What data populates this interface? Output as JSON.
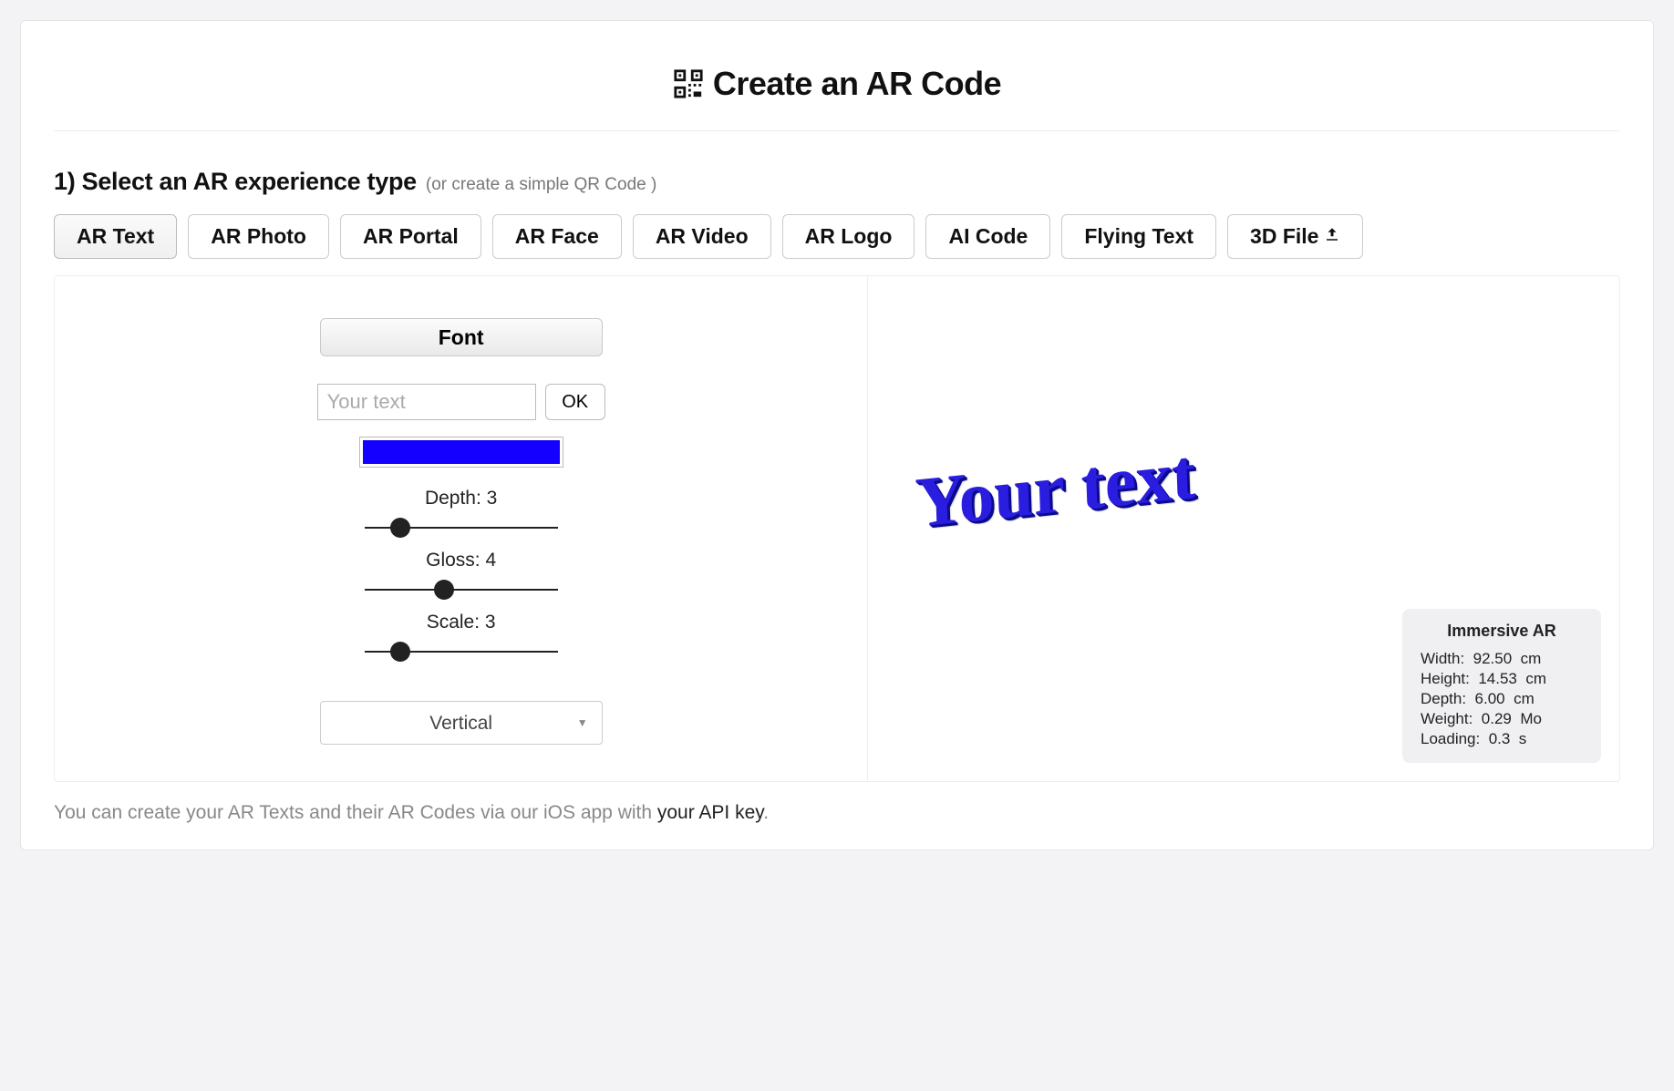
{
  "header": {
    "title": "Create an AR Code",
    "icon": "qr-code-icon"
  },
  "step1": {
    "heading": "1) Select an AR experience type",
    "hint": "(or create a simple QR Code )"
  },
  "tabs": [
    {
      "id": "ar-text",
      "label": "AR Text",
      "active": true
    },
    {
      "id": "ar-photo",
      "label": "AR Photo",
      "active": false
    },
    {
      "id": "ar-portal",
      "label": "AR Portal",
      "active": false
    },
    {
      "id": "ar-face",
      "label": "AR Face",
      "active": false
    },
    {
      "id": "ar-video",
      "label": "AR Video",
      "active": false
    },
    {
      "id": "ar-logo",
      "label": "AR Logo",
      "active": false
    },
    {
      "id": "ai-code",
      "label": "AI Code",
      "active": false
    },
    {
      "id": "flying-text",
      "label": "Flying Text",
      "active": false
    },
    {
      "id": "3d-file",
      "label": "3D File",
      "active": false,
      "has_upload_icon": true
    }
  ],
  "editor": {
    "font_button": "Font",
    "text_placeholder": "Your text",
    "text_value": "",
    "ok_button": "OK",
    "color_hex": "#1400ff",
    "sliders": {
      "depth": {
        "label": "Depth:",
        "value": 3,
        "min": 0,
        "max": 20
      },
      "gloss": {
        "label": "Gloss:",
        "value": 4,
        "min": 0,
        "max": 10
      },
      "scale": {
        "label": "Scale:",
        "value": 3,
        "min": 0,
        "max": 20
      }
    },
    "orientation_selected": "Vertical"
  },
  "preview": {
    "text": "Your text"
  },
  "info": {
    "title": "Immersive AR",
    "rows": {
      "width": {
        "label": "Width:",
        "value": "92.50",
        "unit": "cm"
      },
      "height": {
        "label": "Height:",
        "value": "14.53",
        "unit": "cm"
      },
      "depth": {
        "label": "Depth:",
        "value": "6.00",
        "unit": "cm"
      },
      "weight": {
        "label": "Weight:",
        "value": "0.29",
        "unit": "Mo"
      },
      "loading": {
        "label": "Loading:",
        "value": "0.3",
        "unit": "s"
      }
    }
  },
  "footnote": {
    "prefix": "You can create your AR Texts and their AR Codes via our iOS app with ",
    "link": "your API key",
    "suffix": "."
  }
}
